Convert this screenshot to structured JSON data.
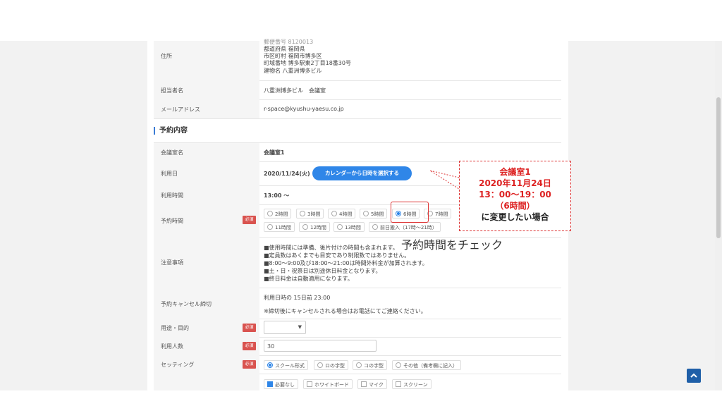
{
  "address": {
    "label": "住所",
    "lines": [
      "郵便番号 8120013",
      "都道府県 福岡県",
      "市区町村 福岡市博多区",
      "町域番地 博多駅東2丁目18番30号",
      "建物名 八重洲博多ビル"
    ]
  },
  "contact": {
    "label": "担当者名",
    "value": "八重洲博多ビル　会議室"
  },
  "email": {
    "label": "メールアドレス",
    "value": "r-space@kyushu-yaesu.co.jp"
  },
  "section_title": "予約内容",
  "room": {
    "label": "会議室名",
    "value": "会議室1"
  },
  "date": {
    "label": "利用日",
    "value": "2020/11/24(火)",
    "button": "カレンダーから日時を選択する"
  },
  "time": {
    "label": "利用時間",
    "value": "13:00 ～"
  },
  "duration": {
    "label": "予約時間",
    "required": "必須",
    "options": [
      "2時間",
      "3時間",
      "4時間",
      "5時間",
      "6時間",
      "7時間",
      "11時間",
      "12時間",
      "13時間",
      "前日搬入（17時～21時）"
    ],
    "selected": "6時間"
  },
  "notes": {
    "label": "注意事項",
    "lines": [
      "■使用時間には準備、後片付けの時間も含まれます。",
      "■定員数はあくまでも目安であり制限数ではありません。",
      "■8:00～9:00及び18:00～21:00は時間外料金が加算されます。",
      "■土・日・祝祭日は別途休日料金となります。",
      "■終日料金は自動適用になります。"
    ]
  },
  "cancel": {
    "label": "予約キャンセル締切",
    "line1": "利用日時の 15日前 23:00",
    "line2": "※締切後にキャンセルされる場合はお電話にてご連絡ください。"
  },
  "purpose": {
    "label": "用途・目的",
    "required": "必須"
  },
  "people": {
    "label": "利用人数",
    "required": "必須",
    "value": "30"
  },
  "setting": {
    "label": "セッティング",
    "required": "必須",
    "options": [
      "スクール形式",
      "ロの字型",
      "コの字型",
      "その他（備考欄に記入）"
    ],
    "selected": "スクール形式"
  },
  "equipment": {
    "options": [
      "必要なし",
      "ホワイトボード",
      "マイク",
      "スクリーン"
    ],
    "checked": "必要なし"
  },
  "callout": {
    "line1": "会議室1",
    "line2": "2020年11月24日",
    "line3": "13：00～19：00",
    "line4": "（6時間）",
    "line5": "に変更したい場合"
  },
  "annotation_note": "予約時間をチェック",
  "colors": {
    "accent": "#2f86e8",
    "required": "#d9534f",
    "callout": "#dd2222",
    "top_button": "#1f5fa8"
  },
  "icons": {
    "back_to_top": "chevron-up-icon",
    "select_caret": "caret-down-icon"
  }
}
